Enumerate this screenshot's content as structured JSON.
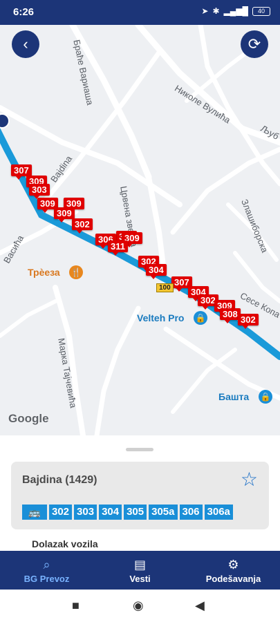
{
  "status_bar": {
    "time": "6:26",
    "battery": "40"
  },
  "map": {
    "streets": [
      "Браће Вариаша",
      "Николе Вулића",
      "Љуб",
      "Bajdina",
      "Црвена звезда",
      "Злашиборска",
      "Васића",
      "Сесе Копа",
      "Марка Тајчевића"
    ],
    "markers": [
      "307",
      "309",
      "303",
      "309",
      "309",
      "309",
      "302",
      "309",
      "306",
      "309",
      "311",
      "302",
      "304",
      "307",
      "304",
      "302",
      "309",
      "308",
      "302"
    ],
    "road_shield": "100",
    "pois": {
      "restaurant": "Трѐеза",
      "velteh": "Velteh Pro",
      "basta": "Башта"
    },
    "google_logo": "Google"
  },
  "stop": {
    "name": "Bajdina (1429)",
    "lines": [
      "302",
      "303",
      "304",
      "305",
      "305a",
      "306",
      "306a"
    ]
  },
  "arrivals_title": "Dolazak vozila",
  "nav": {
    "items": [
      {
        "label": "BG Prevoz",
        "icon": "search-icon"
      },
      {
        "label": "Vesti",
        "icon": "newspaper-icon"
      },
      {
        "label": "Podešavanja",
        "icon": "gear-icon"
      }
    ]
  },
  "colors": {
    "primary": "#1c3578",
    "line_chip": "#1a8fd8",
    "marker": "#e00000"
  }
}
